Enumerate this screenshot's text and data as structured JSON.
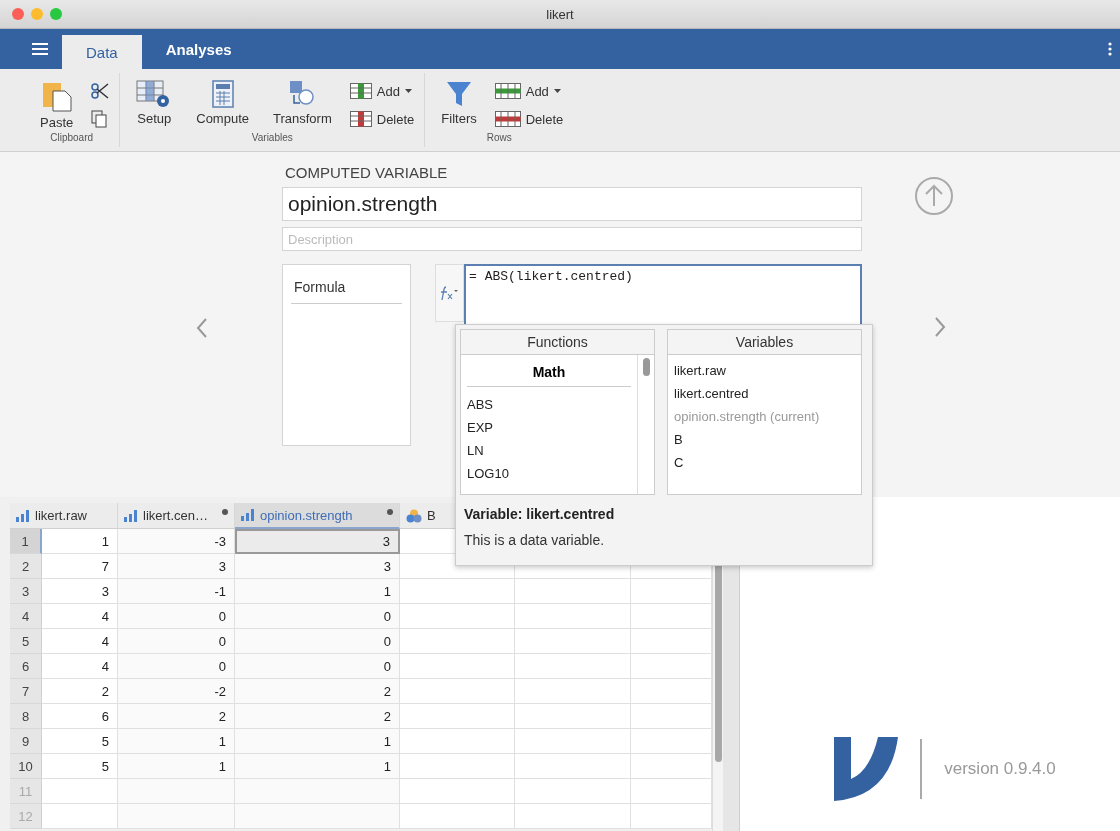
{
  "window": {
    "title": "likert"
  },
  "tabs": [
    {
      "label": "Data",
      "selected": true
    },
    {
      "label": "Analyses",
      "selected": false
    }
  ],
  "ribbon": {
    "groups": [
      {
        "label": "Clipboard",
        "items": [
          {
            "kind": "paste",
            "label": "Paste"
          },
          {
            "kind": "stack",
            "items": [
              {
                "kind": "cut"
              },
              {
                "kind": "copy"
              }
            ]
          }
        ]
      },
      {
        "label": "Variables",
        "items": [
          {
            "kind": "setup",
            "label": "Setup"
          },
          {
            "kind": "compute",
            "label": "Compute"
          },
          {
            "kind": "transform",
            "label": "Transform"
          },
          {
            "kind": "stack",
            "items": [
              {
                "kind": "add_column",
                "label": "Add",
                "dropdown": true
              },
              {
                "kind": "delete_column",
                "label": "Delete",
                "dropdown": false
              }
            ]
          }
        ]
      },
      {
        "label": "Rows",
        "items": [
          {
            "kind": "filter",
            "label": "Filters"
          },
          {
            "kind": "stack",
            "items": [
              {
                "kind": "add_row",
                "label": "Add",
                "dropdown": true
              },
              {
                "kind": "delete_row",
                "label": "Delete",
                "dropdown": false
              }
            ]
          }
        ]
      }
    ]
  },
  "editor": {
    "heading": "COMPUTED VARIABLE",
    "name": "opinion.strength",
    "description": {
      "placeholder": "Description"
    },
    "formula_label": "Formula",
    "formula": "= ABS(likert.centred)",
    "functions": {
      "title": "Functions",
      "group": "Math",
      "items": [
        "ABS",
        "EXP",
        "LN",
        "LOG10"
      ]
    },
    "variables": {
      "title": "Variables",
      "items": [
        {
          "name": "likert.raw",
          "disabled": false
        },
        {
          "name": "likert.centred",
          "disabled": false
        },
        {
          "name": "opinion.strength (current)",
          "disabled": true
        },
        {
          "name": "B",
          "disabled": false
        },
        {
          "name": "C",
          "disabled": false
        }
      ]
    },
    "info": {
      "title": "Variable: likert.centred",
      "text": "This is a data variable."
    }
  },
  "table": {
    "columns": [
      {
        "name": "likert.raw",
        "kind": "continuous",
        "computed": false,
        "selected": false
      },
      {
        "name": "likert.cen…",
        "kind": "continuous",
        "computed": true,
        "selected": false
      },
      {
        "name": "opinion.strength",
        "kind": "continuous",
        "computed": true,
        "selected": true
      },
      {
        "name": "B",
        "kind": "nominal",
        "computed": false,
        "selected": false
      }
    ],
    "rows": [
      {
        "number": "1",
        "values": [
          "1",
          "-3",
          "3"
        ],
        "selected": true,
        "in_data": true
      },
      {
        "number": "2",
        "values": [
          "7",
          "3",
          "3"
        ],
        "selected": false,
        "in_data": true
      },
      {
        "number": "3",
        "values": [
          "3",
          "-1",
          "1"
        ],
        "selected": false,
        "in_data": true
      },
      {
        "number": "4",
        "values": [
          "4",
          "0",
          "0"
        ],
        "selected": false,
        "in_data": true
      },
      {
        "number": "5",
        "values": [
          "4",
          "0",
          "0"
        ],
        "selected": false,
        "in_data": true
      },
      {
        "number": "6",
        "values": [
          "4",
          "0",
          "0"
        ],
        "selected": false,
        "in_data": true
      },
      {
        "number": "7",
        "values": [
          "2",
          "-2",
          "2"
        ],
        "selected": false,
        "in_data": true
      },
      {
        "number": "8",
        "values": [
          "6",
          "2",
          "2"
        ],
        "selected": false,
        "in_data": true
      },
      {
        "number": "9",
        "values": [
          "5",
          "1",
          "1"
        ],
        "selected": false,
        "in_data": true
      },
      {
        "number": "10",
        "values": [
          "5",
          "1",
          "1"
        ],
        "selected": false,
        "in_data": true
      },
      {
        "number": "11",
        "selected": false,
        "in_data": false
      },
      {
        "number": "12",
        "selected": false,
        "in_data": false
      }
    ]
  },
  "about": {
    "version": "version 0.9.4.0"
  }
}
